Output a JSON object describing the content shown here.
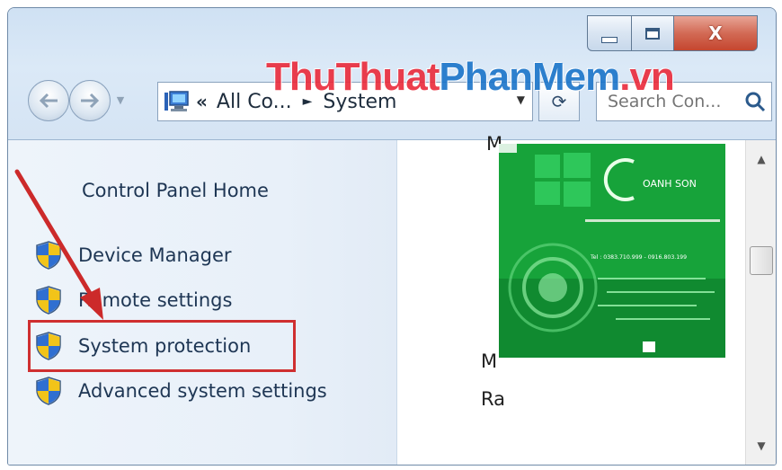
{
  "window": {
    "caption": {
      "minimize": "—",
      "maximize": "□",
      "close": "X"
    }
  },
  "watermark": {
    "part1": "ThuThuat",
    "part2": "PhanMem",
    "part3": ".vn"
  },
  "address": {
    "prefix": "«",
    "crumbs": [
      "All Co...",
      "System"
    ],
    "separator": "►"
  },
  "search": {
    "placeholder": "Search Con..."
  },
  "left_pane": {
    "home_link": "Control Panel Home",
    "tasks": [
      {
        "label": "Device Manager",
        "icon": "uac-shield-icon"
      },
      {
        "label": "Remote settings",
        "icon": "uac-shield-icon"
      },
      {
        "label": "System protection",
        "icon": "uac-shield-icon",
        "highlighted": true
      },
      {
        "label": "Advanced system settings",
        "icon": "uac-shield-icon"
      }
    ]
  },
  "right_pane": {
    "text_top": "M",
    "text_mid": "M",
    "text_ra": "Ra",
    "logo_text": {
      "brand": "OANH SON",
      "phone": "Tel : 0383.710.999 - 0916.803.199"
    }
  },
  "colors": {
    "highlight": "#cf2f30",
    "arrow": "#cc2a2a",
    "watermark_red": "#ea2a3a",
    "watermark_blue": "#1a74c9",
    "logo_green": "#17a33a"
  }
}
